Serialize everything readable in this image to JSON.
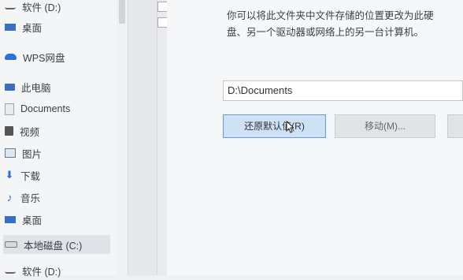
{
  "nav": {
    "items": [
      {
        "label": "软件 (D:)",
        "icon": "drive-icon"
      },
      {
        "label": "桌面",
        "icon": "desktop-icon"
      },
      {
        "label": "WPS网盘",
        "icon": "cloud-icon"
      },
      {
        "label": "此电脑",
        "icon": "computer-icon"
      },
      {
        "label": "Documents",
        "icon": "document-icon"
      },
      {
        "label": "视频",
        "icon": "video-icon"
      },
      {
        "label": "图片",
        "icon": "picture-icon"
      },
      {
        "label": "下载",
        "icon": "download-icon"
      },
      {
        "label": "音乐",
        "icon": "music-icon"
      },
      {
        "label": "桌面",
        "icon": "desktop-icon"
      },
      {
        "label": "本地磁盘 (C:)",
        "icon": "drive-icon"
      },
      {
        "label": "软件 (D:)",
        "icon": "drive-icon"
      }
    ]
  },
  "main": {
    "description_line1": "你可以将此文件夹中文件存储的位置更改为此硬",
    "description_line2": "盘、另一个驱动器或网络上的另一台计算机。",
    "path_value": "D:\\Documents",
    "restore_default_label": "还原默认值(R)",
    "move_label": "移动(M)..."
  },
  "colors": {
    "accent": "#3a6fc4",
    "selection": "#dfe3e8"
  }
}
